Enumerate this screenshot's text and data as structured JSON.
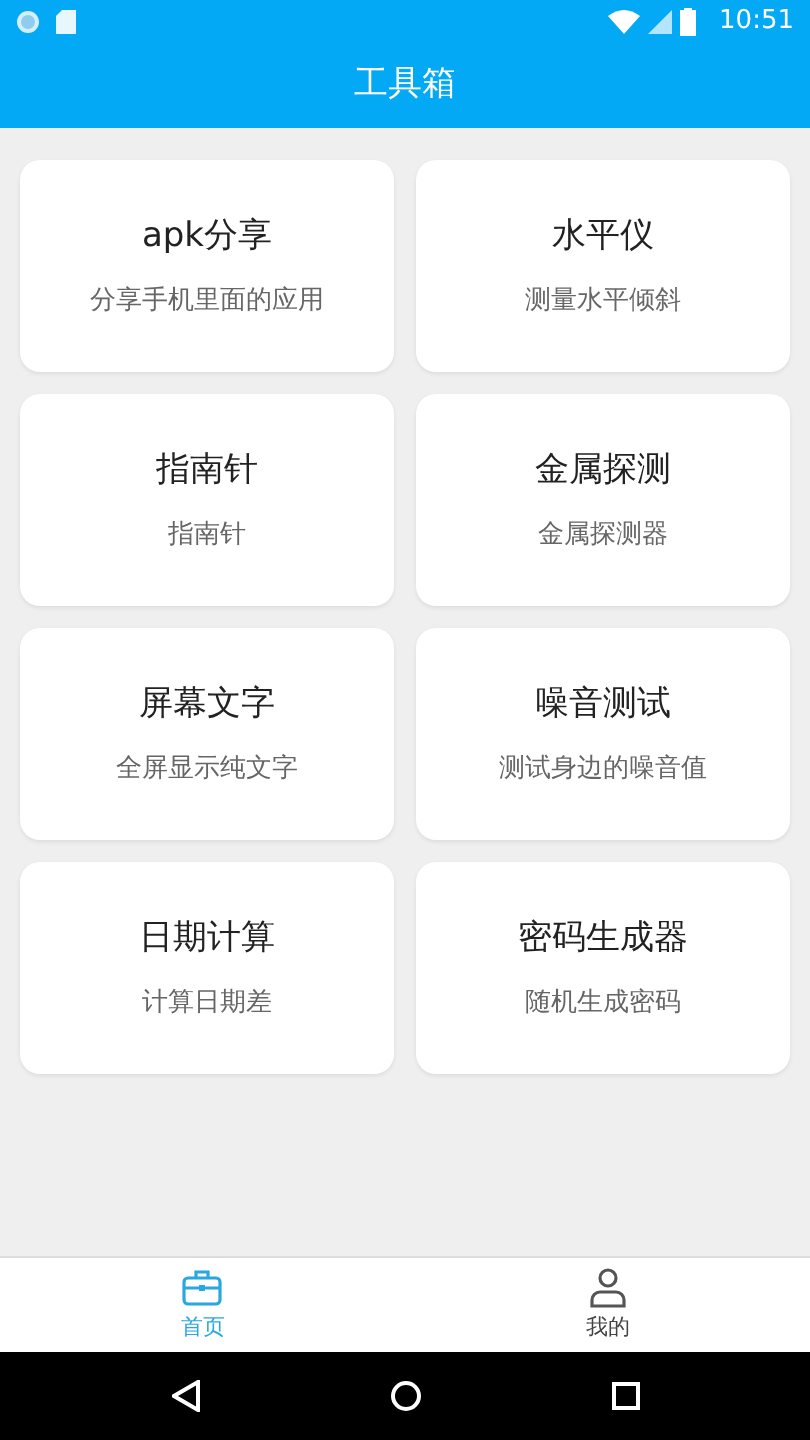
{
  "status_bar": {
    "time": "10:51"
  },
  "app_bar": {
    "title": "工具箱"
  },
  "tools": [
    {
      "title": "apk分享",
      "subtitle": "分享手机里面的应用"
    },
    {
      "title": "水平仪",
      "subtitle": "测量水平倾斜"
    },
    {
      "title": "指南针",
      "subtitle": "指南针"
    },
    {
      "title": "金属探测",
      "subtitle": "金属探测器"
    },
    {
      "title": "屏幕文字",
      "subtitle": "全屏显示纯文字"
    },
    {
      "title": "噪音测试",
      "subtitle": "测试身边的噪音值"
    },
    {
      "title": "日期计算",
      "subtitle": "计算日期差"
    },
    {
      "title": "密码生成器",
      "subtitle": "随机生成密码"
    }
  ],
  "bottom_tabs": [
    {
      "label": "首页",
      "kind": "toolbox",
      "selected": true
    },
    {
      "label": "我的",
      "kind": "person",
      "selected": false
    }
  ]
}
